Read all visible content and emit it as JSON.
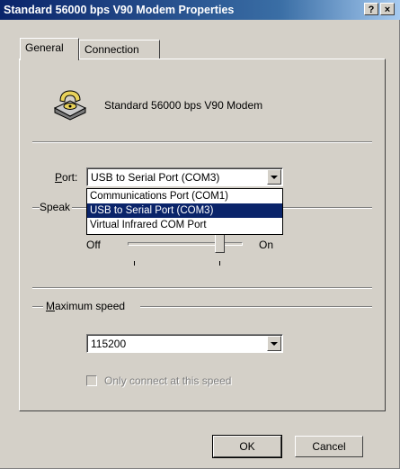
{
  "window": {
    "title": "Standard 56000 bps V90 Modem Properties",
    "help_button": "?",
    "close_button": "×"
  },
  "tabs": [
    {
      "label": "General",
      "active": true
    },
    {
      "label": "Connection",
      "active": false
    }
  ],
  "general": {
    "device_icon": "modem-telephone-icon",
    "device_name": "Standard 56000 bps V90 Modem",
    "port": {
      "label_underlined": "P",
      "label_rest": "ort:",
      "value": "USB to Serial Port (COM3)",
      "options": [
        "Communications Port (COM1)",
        "USB to Serial Port (COM3)",
        "Virtual Infrared COM Port"
      ],
      "selected_index": 1
    },
    "speaker": {
      "group_label": "Speak",
      "min_label": "Off",
      "max_label": "On",
      "level_fraction": 0.8
    },
    "maximum_speed": {
      "label_underlined": "M",
      "label_rest": "aximum speed",
      "value": "115200",
      "only_connect_label": "Only connect at this speed",
      "only_connect_checked": false,
      "only_connect_enabled": false
    }
  },
  "buttons": {
    "ok": "OK",
    "cancel": "Cancel"
  },
  "colors": {
    "titlebar_start": "#0a246a",
    "face": "#d4d0c8",
    "selection": "#0a246a"
  }
}
